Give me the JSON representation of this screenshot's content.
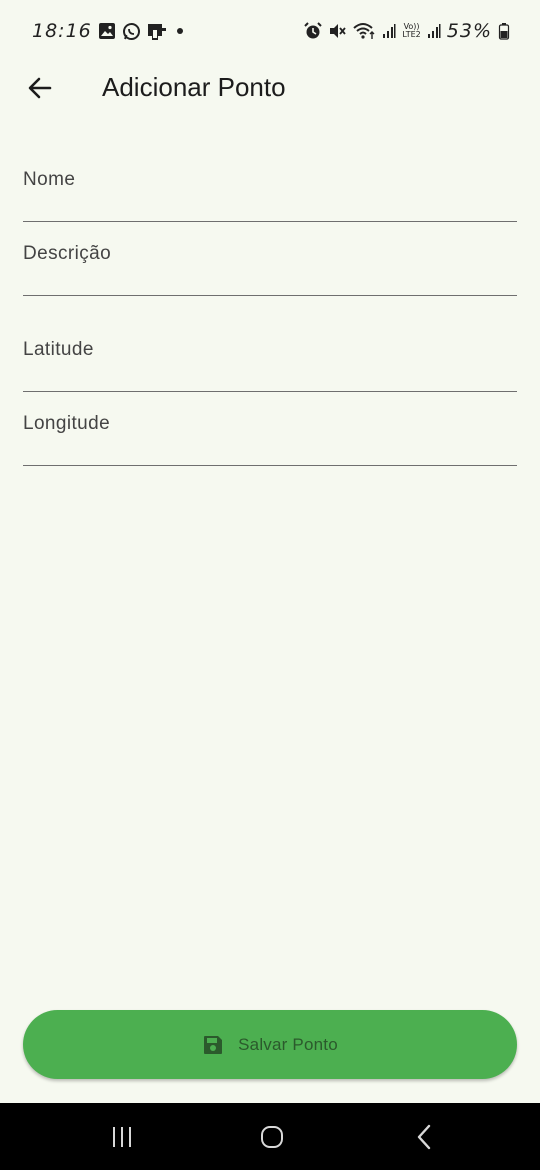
{
  "status_bar": {
    "time": "18:16",
    "battery": "53%",
    "volte_line1": "Vo))",
    "volte_line2": "LTE2",
    "icons": [
      "image-icon",
      "whatsapp-icon",
      "clipboard-icon",
      "dot-icon",
      "alarm-icon",
      "mute-icon",
      "wifi-icon",
      "signal-icon",
      "battery-icon"
    ]
  },
  "app_bar": {
    "title": "Adicionar Ponto",
    "back_icon": "arrow-back-icon"
  },
  "form": {
    "nome": {
      "placeholder": "Nome",
      "value": ""
    },
    "descricao": {
      "placeholder": "Descrição",
      "value": ""
    },
    "latitude": {
      "placeholder": "Latitude",
      "value": ""
    },
    "longitude": {
      "placeholder": "Longitude",
      "value": ""
    }
  },
  "save_button": {
    "label": "Salvar Ponto",
    "icon": "save-icon"
  },
  "nav_bar": {
    "icons": [
      "recents-icon",
      "home-icon",
      "back-icon"
    ]
  },
  "colors": {
    "background": "#f6f9f0",
    "accent": "#4caf50",
    "button_text": "#2b5a2c",
    "nav_bar": "#000000"
  }
}
